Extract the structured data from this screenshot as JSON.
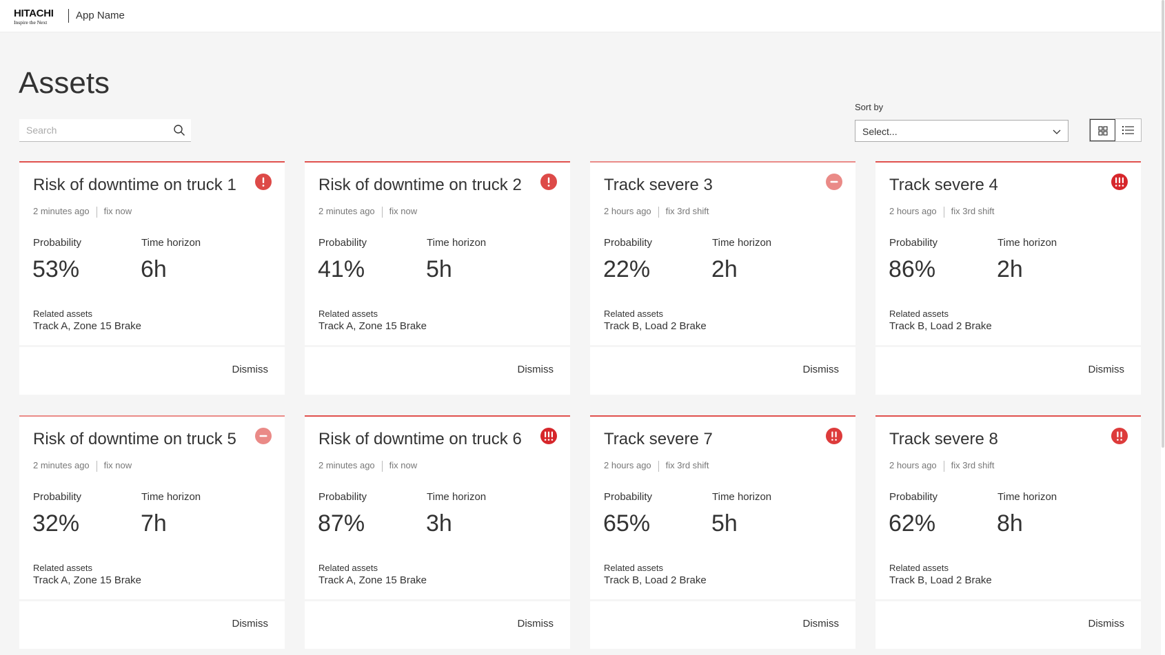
{
  "header": {
    "logo_word": "HITACHI",
    "logo_tag": "Inspire the Next",
    "app_name": "App Name"
  },
  "page": {
    "title": "Assets",
    "search_placeholder": "Search",
    "sort_label": "Sort by",
    "sort_value": "Select..."
  },
  "labels": {
    "probability": "Probability",
    "time_horizon": "Time horizon",
    "related_assets": "Related assets",
    "dismiss": "Dismiss"
  },
  "colors": {
    "accent_red": "#e0504d",
    "accent_light_red": "#ea8a87",
    "badge_red": "#dd3b3b"
  },
  "cards": [
    {
      "title": "Risk of downtime on truck 1",
      "time": "2 minutes ago",
      "action": "fix now",
      "probability": "53%",
      "horizon": "6h",
      "related": "Track A, Zone 15 Brake",
      "severity": "high-icon"
    },
    {
      "title": "Risk of downtime on truck 2",
      "time": "2 minutes ago",
      "action": "fix now",
      "probability": "41%",
      "horizon": "5h",
      "related": "Track A, Zone 15 Brake",
      "severity": "high-icon"
    },
    {
      "title": "Track severe 3",
      "time": "2 hours ago",
      "action": "fix 3rd shift",
      "probability": "22%",
      "horizon": "2h",
      "related": "Track B, Load 2 Brake",
      "severity": "low-icon"
    },
    {
      "title": "Track severe 4",
      "time": "2 hours ago",
      "action": "fix 3rd shift",
      "probability": "86%",
      "horizon": "2h",
      "related": "Track B, Load 2 Brake",
      "severity": "critical-icon"
    },
    {
      "title": "Risk of downtime on truck 5",
      "time": "2 minutes ago",
      "action": "fix now",
      "probability": "32%",
      "horizon": "7h",
      "related": "Track A, Zone 15 Brake",
      "severity": "low-icon"
    },
    {
      "title": "Risk of downtime on truck 6",
      "time": "2 minutes ago",
      "action": "fix now",
      "probability": "87%",
      "horizon": "3h",
      "related": "Track A, Zone 15 Brake",
      "severity": "critical-icon"
    },
    {
      "title": "Track severe 7",
      "time": "2 hours ago",
      "action": "fix 3rd shift",
      "probability": "65%",
      "horizon": "5h",
      "related": "Track B, Load 2 Brake",
      "severity": "major-icon"
    },
    {
      "title": "Track severe 8",
      "time": "2 hours ago",
      "action": "fix 3rd shift",
      "probability": "62%",
      "horizon": "8h",
      "related": "Track B, Load 2 Brake",
      "severity": "major-icon"
    }
  ]
}
